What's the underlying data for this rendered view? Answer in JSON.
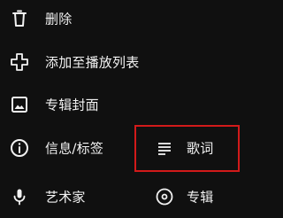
{
  "menu": {
    "items": [
      {
        "label": "删除",
        "icon": "trash-icon"
      },
      {
        "label": "添加至播放列表",
        "icon": "plus-icon"
      },
      {
        "label": "专辑封面",
        "icon": "image-icon"
      },
      {
        "label": "信息/标签",
        "icon": "info-icon"
      },
      {
        "label": "艺术家",
        "icon": "microphone-icon"
      }
    ],
    "right_items": [
      {
        "label": "歌词",
        "icon": "lyrics-icon"
      },
      {
        "label": "专辑",
        "icon": "album-icon"
      }
    ]
  },
  "colors": {
    "background": "#101010",
    "text": "#f2f2f2",
    "highlight": "#d21a1a"
  }
}
